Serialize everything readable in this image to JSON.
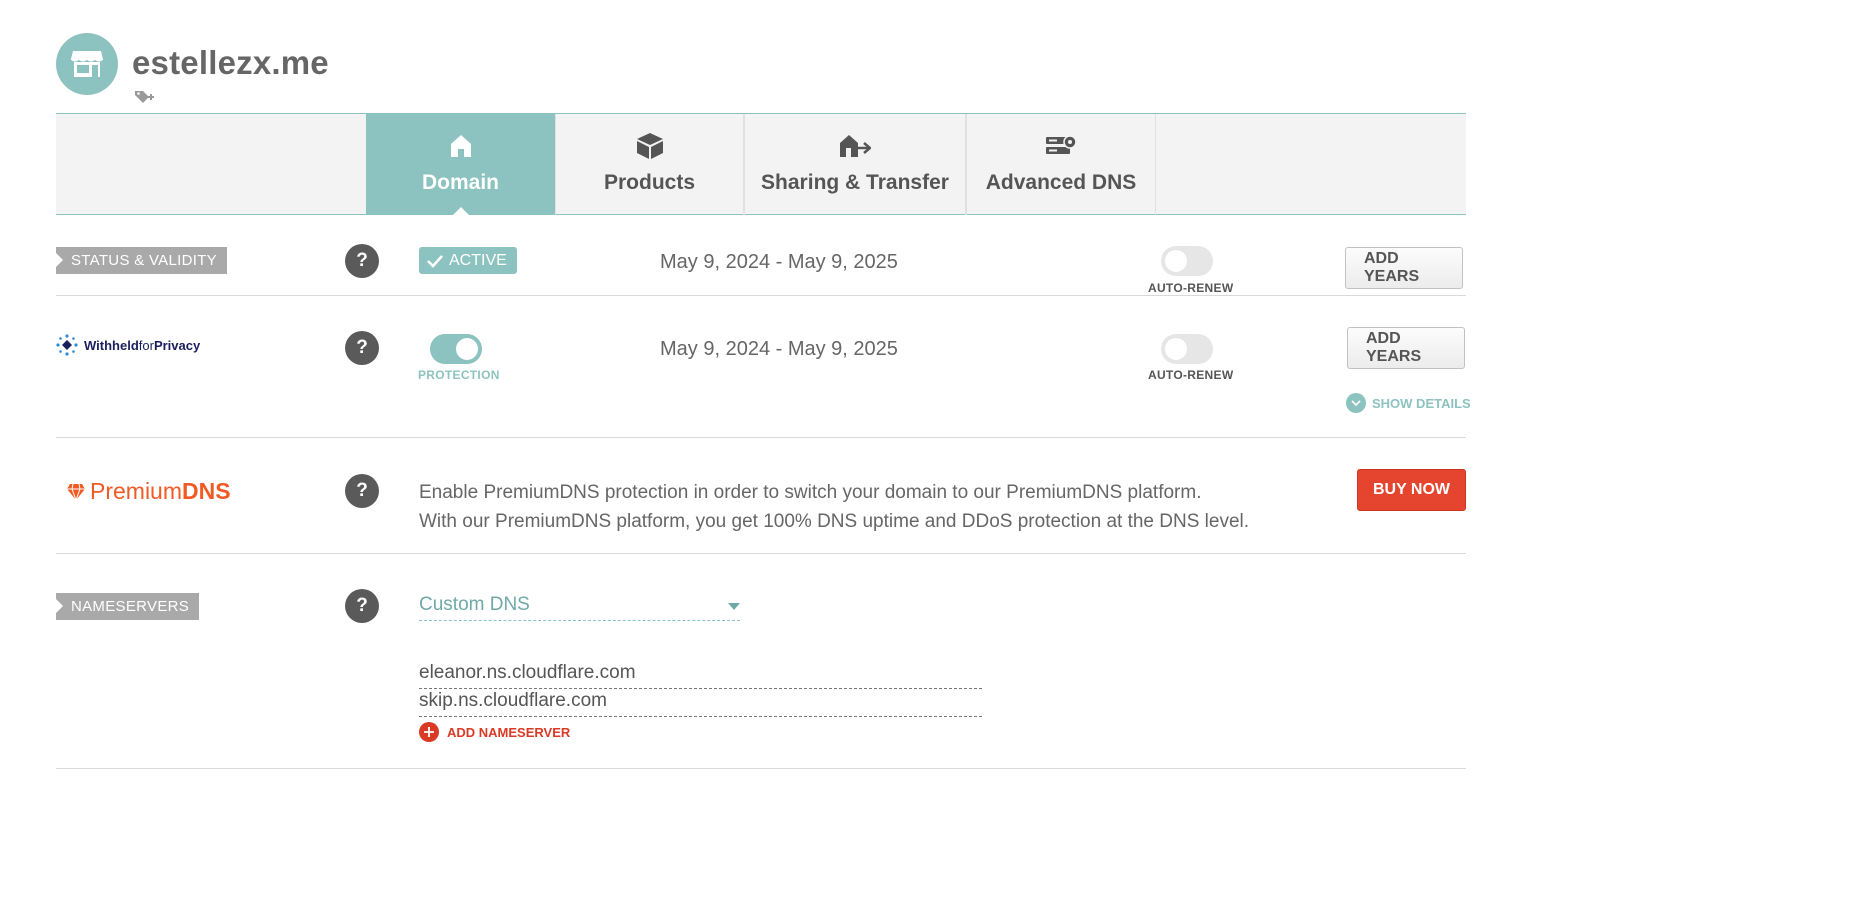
{
  "header": {
    "domain": "estellezx.me",
    "avatar_icon": "storefront-icon",
    "tag_icon": "add-tag-icon"
  },
  "tabs": [
    {
      "label": "Domain",
      "icon": "home-icon",
      "active": true
    },
    {
      "label": "Products",
      "icon": "box-icon",
      "active": false
    },
    {
      "label": "Sharing & Transfer",
      "icon": "house-transfer-icon",
      "active": false
    },
    {
      "label": "Advanced DNS",
      "icon": "server-gear-icon",
      "active": false
    }
  ],
  "status": {
    "section_label": "STATUS & VALIDITY",
    "badge": "ACTIVE",
    "dates": "May 9, 2024 - May 9, 2025",
    "auto_renew_label": "AUTO-RENEW",
    "auto_renew_on": false,
    "add_years_label": "ADD YEARS"
  },
  "privacy": {
    "brand_withheld": "Withheld",
    "brand_for": "for",
    "brand_privacy": "Privacy",
    "protection_label": "PROTECTION",
    "protection_on": true,
    "dates": "May 9, 2024 - May 9, 2025",
    "auto_renew_label": "AUTO-RENEW",
    "auto_renew_on": false,
    "add_years_label": "ADD YEARS",
    "show_details_label": "SHOW DETAILS"
  },
  "premium": {
    "brand_premium": "Premium",
    "brand_dns": "DNS",
    "line1": "Enable PremiumDNS protection in order to switch your domain to our PremiumDNS platform.",
    "line2": "With our PremiumDNS platform, you get 100% DNS uptime and DDoS protection at the DNS level.",
    "buy_label": "BUY NOW"
  },
  "nameservers": {
    "section_label": "NAMESERVERS",
    "selected": "Custom DNS",
    "servers": [
      "eleanor.ns.cloudflare.com",
      "skip.ns.cloudflare.com"
    ],
    "add_label": "ADD NAMESERVER"
  },
  "colors": {
    "accent": "#8cc3c1",
    "danger": "#e5452e",
    "premium_orange": "#f15a24",
    "privacy_navy": "#1a1f5c"
  },
  "help_glyph": "?"
}
